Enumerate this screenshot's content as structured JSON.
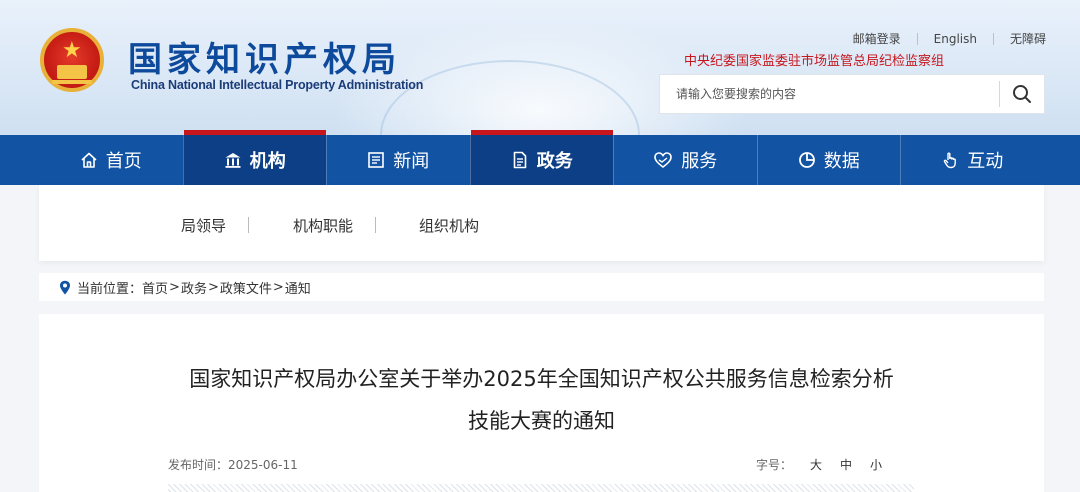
{
  "header": {
    "title": "国家知识产权局",
    "subtitle": "China National Intellectual Property Administration",
    "top_links": [
      "邮箱登录",
      "English",
      "无障碍"
    ],
    "notice": "中央纪委国家监委驻市场监管总局纪检监察组",
    "search": {
      "placeholder": "请输入您要搜索的内容"
    }
  },
  "nav": {
    "items": [
      {
        "label": "首页",
        "icon": "home-icon"
      },
      {
        "label": "机构",
        "icon": "institution-icon",
        "active": true
      },
      {
        "label": "新闻",
        "icon": "news-icon"
      },
      {
        "label": "政务",
        "icon": "document-icon",
        "active": true
      },
      {
        "label": "服务",
        "icon": "heart-hand-icon"
      },
      {
        "label": "数据",
        "icon": "pie-chart-icon"
      },
      {
        "label": "互动",
        "icon": "hand-pointer-icon"
      }
    ]
  },
  "submenu": {
    "items": [
      "局领导",
      "机构职能",
      "组织机构"
    ]
  },
  "breadcrumb": {
    "label": "当前位置：",
    "items": [
      "首页",
      "政务",
      "政策文件",
      "通知"
    ],
    "separator": ">"
  },
  "article": {
    "title_line1": "国家知识产权局办公室关于举办2025年全国知识产权公共服务信息检索分析",
    "title_line2": "技能大赛的通知",
    "publish_label": "发布时间：",
    "publish_date": "2025-06-11",
    "font_size_label": "字号：",
    "font_sizes": [
      "大",
      "中",
      "小"
    ]
  },
  "colors": {
    "brand_blue": "#1253a4",
    "active_blue": "#0d3f86",
    "accent_red": "#c8161d"
  }
}
